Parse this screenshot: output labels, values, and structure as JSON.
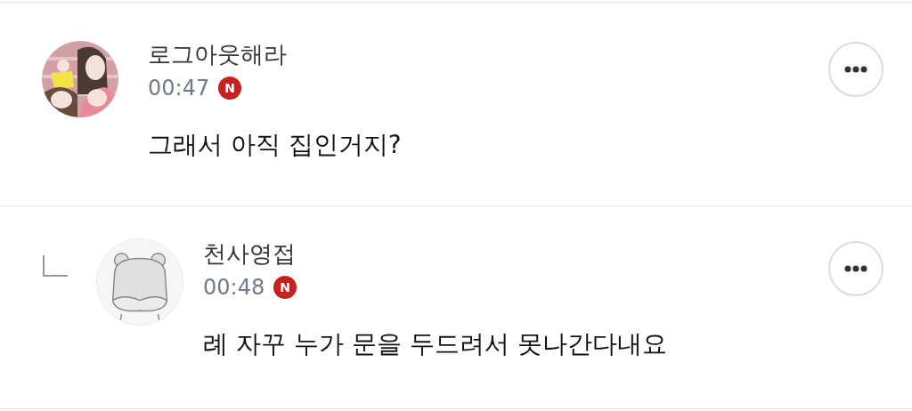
{
  "comments": [
    {
      "kind": "comment",
      "author": "로그아웃해라",
      "time": "00:47",
      "badge": "N",
      "text": "그래서 아직 집인거지?"
    },
    {
      "kind": "reply",
      "author": "천사영접",
      "time": "00:48",
      "badge": "N",
      "text": "례 자꾸 누가 문을 두드려서 못나간다내요",
      "avatar": {
        "kind": "silhouette"
      }
    }
  ]
}
